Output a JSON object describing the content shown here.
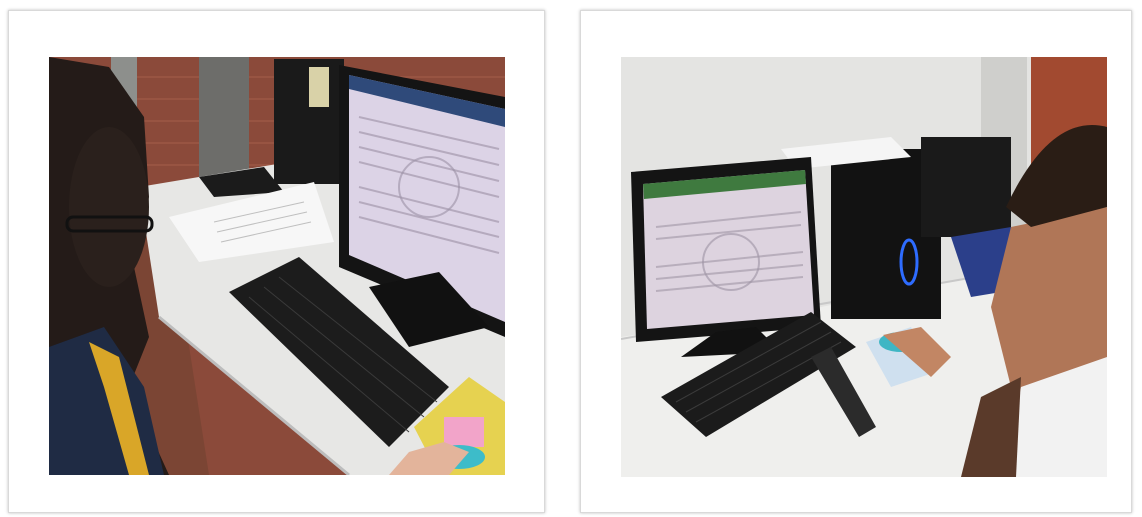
{
  "photos": [
    {
      "id": "left",
      "subject": "student-at-computer-left",
      "colors": {
        "brick": "#9a4b35",
        "desk": "#e7e7e5",
        "monitor": "#151515",
        "screen": "#d9cfe3",
        "hair": "#241b18",
        "jacket": "#1f2b44",
        "yellow": "#d9a628"
      }
    },
    {
      "id": "right",
      "subject": "student-at-computer-right",
      "colors": {
        "wall": "#e6e6e4",
        "desk": "#efefed",
        "monitor": "#151515",
        "screen": "#dfd6e0",
        "skin": "#b07657",
        "hair": "#2a1d15",
        "shirt": "#f2f2f2",
        "jacket": "#2b3f8a"
      }
    }
  ]
}
